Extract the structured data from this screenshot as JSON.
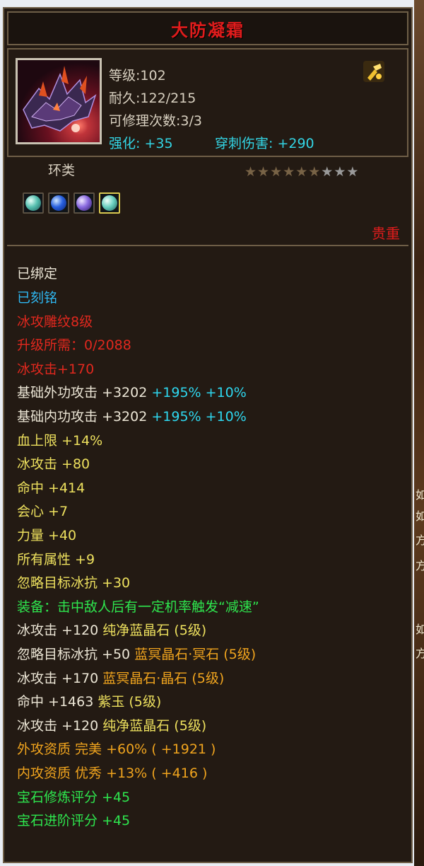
{
  "item": {
    "name": "大防凝霜",
    "level": "等级:102",
    "durability": "耐久:122/215",
    "repairs": "可修理次数:3/3",
    "enhance": "强化: +35",
    "pierce": "穿刺伤害: +290",
    "type": "环类",
    "rarity": "贵重",
    "stars_filled": 6,
    "stars_total": 9
  },
  "gems": [
    {
      "name": "jade-gem-icon",
      "color": "#56c0b0"
    },
    {
      "name": "blue-crystal-icon",
      "color": "#2860e0"
    },
    {
      "name": "purple-crystal-icon",
      "color": "#8a6ae0"
    },
    {
      "name": "jade-gem-icon",
      "color": "#6ad0c0"
    }
  ],
  "lines": [
    {
      "t": "已绑定"
    },
    {
      "t": "已刻铭"
    },
    {
      "t": "冰攻雕纹8级"
    },
    {
      "t": "升级所需：0/2088"
    },
    {
      "t": "冰攻击+170"
    },
    {
      "a": "基础外功攻击 +3202 ",
      "b": "+195% +10%"
    },
    {
      "a": "基础内功攻击 +3202 ",
      "b": "+195% +10%"
    },
    {
      "t": "血上限 +14%"
    },
    {
      "t": "冰攻击 +80"
    },
    {
      "t": "命中 +414"
    },
    {
      "t": "会心 +7"
    },
    {
      "t": "力量 +40"
    },
    {
      "t": "所有属性 +9"
    },
    {
      "t": "忽略目标冰抗 +30"
    },
    {
      "t": "装备：击中敌人后有一定机率触发“减速”"
    },
    {
      "a": "冰攻击 +120 ",
      "b": "纯净蓝晶石 (5级)"
    },
    {
      "a": "忽略目标冰抗 +50 ",
      "b": "蓝冥晶石·冥石 (5级)"
    },
    {
      "a": "冰攻击 +170 ",
      "b": "蓝冥晶石·晶石 (5级)"
    },
    {
      "a": "命中 +1463 ",
      "b": "紫玉 (5级)"
    },
    {
      "a": "冰攻击 +120 ",
      "b": "纯净蓝晶石 (5级)"
    },
    {
      "t": "外攻资质  完美 +60% ( +1921 )"
    },
    {
      "t": "内攻资质  优秀 +13% ( +416 )"
    },
    {
      "t": "宝石修炼评分 +45"
    },
    {
      "t": "宝石进阶评分 +45"
    }
  ],
  "bg_fragments": [
    "如",
    "如",
    "方",
    "方",
    "如",
    "方"
  ]
}
